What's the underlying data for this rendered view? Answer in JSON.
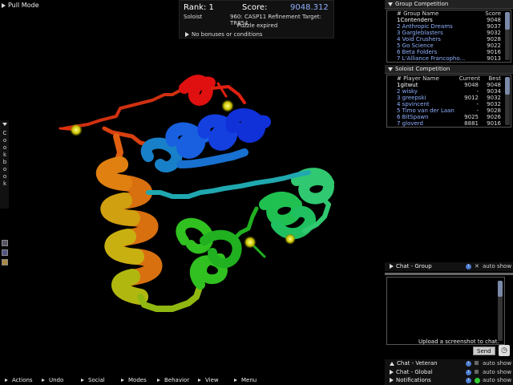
{
  "app": {
    "pull_mode": "Pull Mode"
  },
  "score_panel": {
    "rank": "Rank: 1",
    "score_label": "Score:",
    "score_value": "9048.312",
    "mode": "Soloist",
    "puzzle": "960: CASP11 Refinement Target: TR854",
    "status": "Puzzle expired",
    "bonus": "No bonuses or conditions"
  },
  "cookbook": {
    "label": "Cookbook"
  },
  "group_competition": {
    "title": "Group Competition",
    "headers": {
      "name": "# Group Name",
      "score": "Score"
    },
    "rows": [
      {
        "name": "1Contenders",
        "score": "9048",
        "own": true
      },
      {
        "name": "2 Anthropic Dreams",
        "score": "9037",
        "own": false
      },
      {
        "name": "3 Gargleblasters",
        "score": "9032",
        "own": false
      },
      {
        "name": "4 Void Crushers",
        "score": "9028",
        "own": false
      },
      {
        "name": "5 Go Science",
        "score": "9022",
        "own": false
      },
      {
        "name": "6 Beta Folders",
        "score": "9016",
        "own": false
      },
      {
        "name": "7 L'Alliance Francopho...",
        "score": "9013",
        "own": false
      }
    ]
  },
  "soloist_competition": {
    "title": "Soloist Competition",
    "headers": {
      "name": "# Player Name",
      "current": "Current",
      "best": "Best"
    },
    "rows": [
      {
        "name": "1gitwut",
        "current": "9048",
        "best": "9048",
        "own": true
      },
      {
        "name": "2 wisky",
        "current": "-",
        "best": "9034",
        "own": false
      },
      {
        "name": "3 greepski",
        "current": "9012",
        "best": "9032",
        "own": false
      },
      {
        "name": "4 spvincent",
        "current": "-",
        "best": "9032",
        "own": false
      },
      {
        "name": "5 Timo van der Laan",
        "current": "-",
        "best": "9028",
        "own": false
      },
      {
        "name": "6 BitSpawn",
        "current": "9025",
        "best": "9026",
        "own": false
      },
      {
        "name": "7 gloverd",
        "current": "8881",
        "best": "9016",
        "own": false
      }
    ]
  },
  "chat": {
    "group_tab": "Chat - Group",
    "auto_show": "auto show",
    "upload_tooltip": "Upload a screenshot to chat.",
    "send_label": "Send",
    "veteran_tab": "Chat - Veteran",
    "global_tab": "Chat - Global",
    "notifications_tab": "Notifications"
  },
  "toolbar": {
    "items": [
      "Actions",
      "Undo",
      "Social",
      "Modes",
      "Behavior",
      "View",
      "Menu"
    ]
  },
  "icons": {
    "info": "info-icon",
    "close": "close-icon",
    "camera": "camera-icon",
    "notification": "notification-dot-icon"
  },
  "colors": {
    "score_value": "#8fb0ff",
    "list_link": "#8fb0ff",
    "scroll_thumb": "#7a8aa8"
  }
}
